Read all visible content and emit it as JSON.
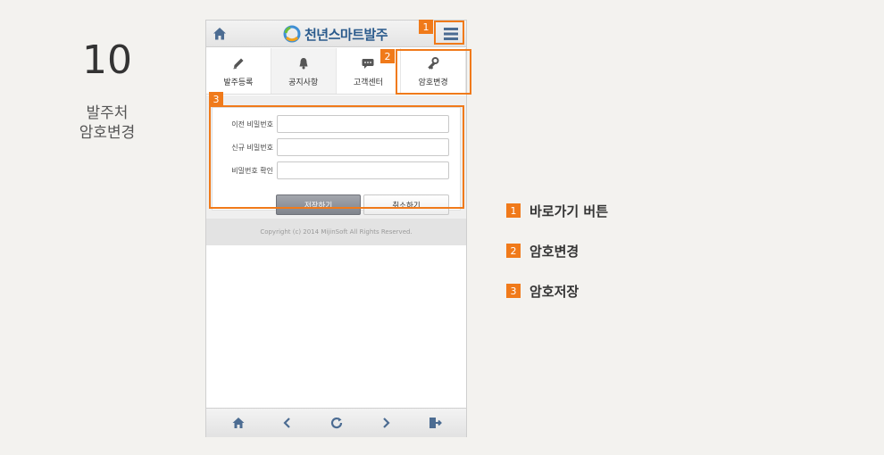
{
  "step": {
    "number": "10",
    "title_line1": "발주처",
    "title_line2": "암호변경"
  },
  "app": {
    "logo_text": "천년스마트발주",
    "tabs": [
      {
        "label": "발주등록",
        "icon": "pencil-icon"
      },
      {
        "label": "공지사항",
        "icon": "bell-icon"
      },
      {
        "label": "고객센터",
        "icon": "chat-icon"
      },
      {
        "label": "암호변경",
        "icon": "key-icon"
      }
    ],
    "form": {
      "old_password_label": "이전 비밀번호",
      "new_password_label": "신규 비밀번호",
      "confirm_password_label": "비밀번호 확인",
      "old_password_value": "",
      "new_password_value": "",
      "confirm_password_value": "",
      "save_label": "저장하기",
      "cancel_label": "취소하기"
    },
    "copyright": "Copyright (c) 2014 MijinSoft All Rights Reserved."
  },
  "callouts": {
    "badge1": "1",
    "badge2": "2",
    "badge3": "3"
  },
  "legend": [
    {
      "num": "1",
      "text": "바로가기 버튼"
    },
    {
      "num": "2",
      "text": "암호변경"
    },
    {
      "num": "3",
      "text": "암호저장"
    }
  ],
  "colors": {
    "accent": "#f07a1a",
    "logo": "#2a5a8c"
  }
}
